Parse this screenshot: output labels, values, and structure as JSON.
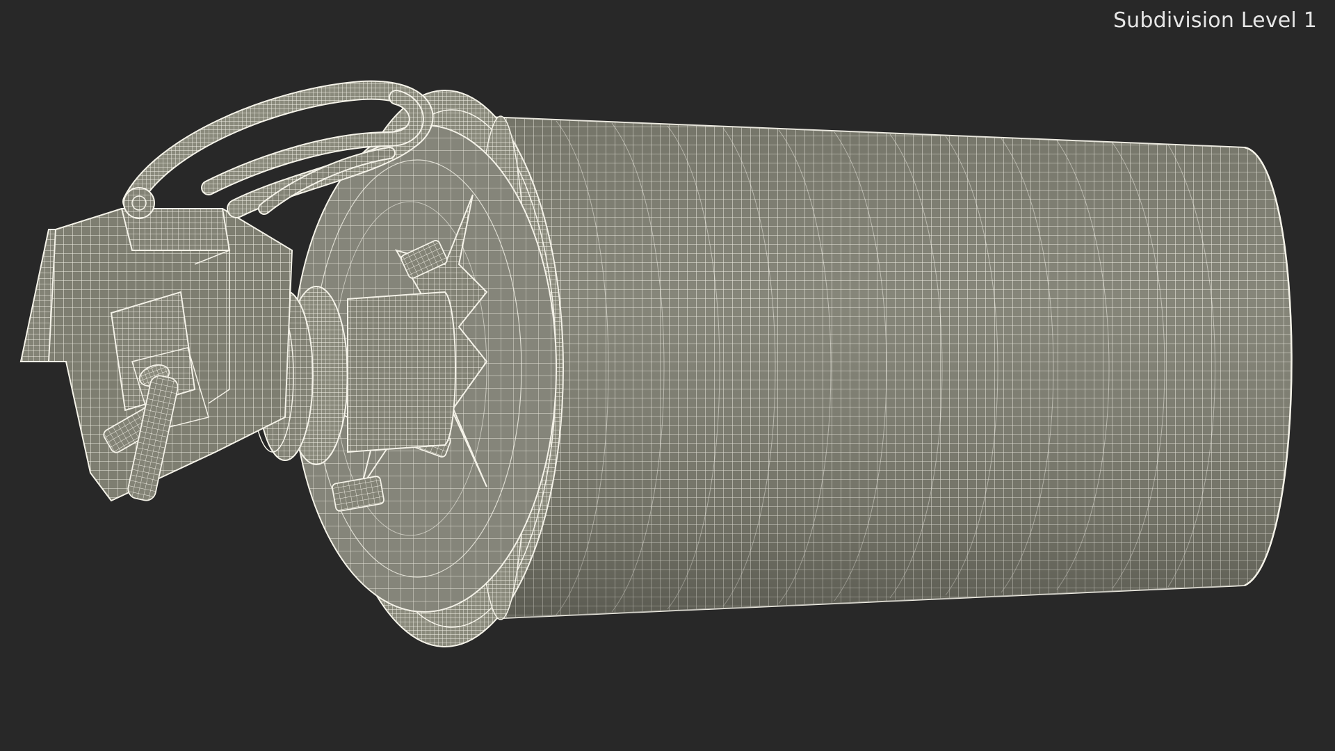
{
  "viewport": {
    "overlay_label": "Subdivision Level 1",
    "background_color": "#282828",
    "mesh_fill_color": "#7f7f72",
    "wire_color": "#f2f0e6"
  }
}
